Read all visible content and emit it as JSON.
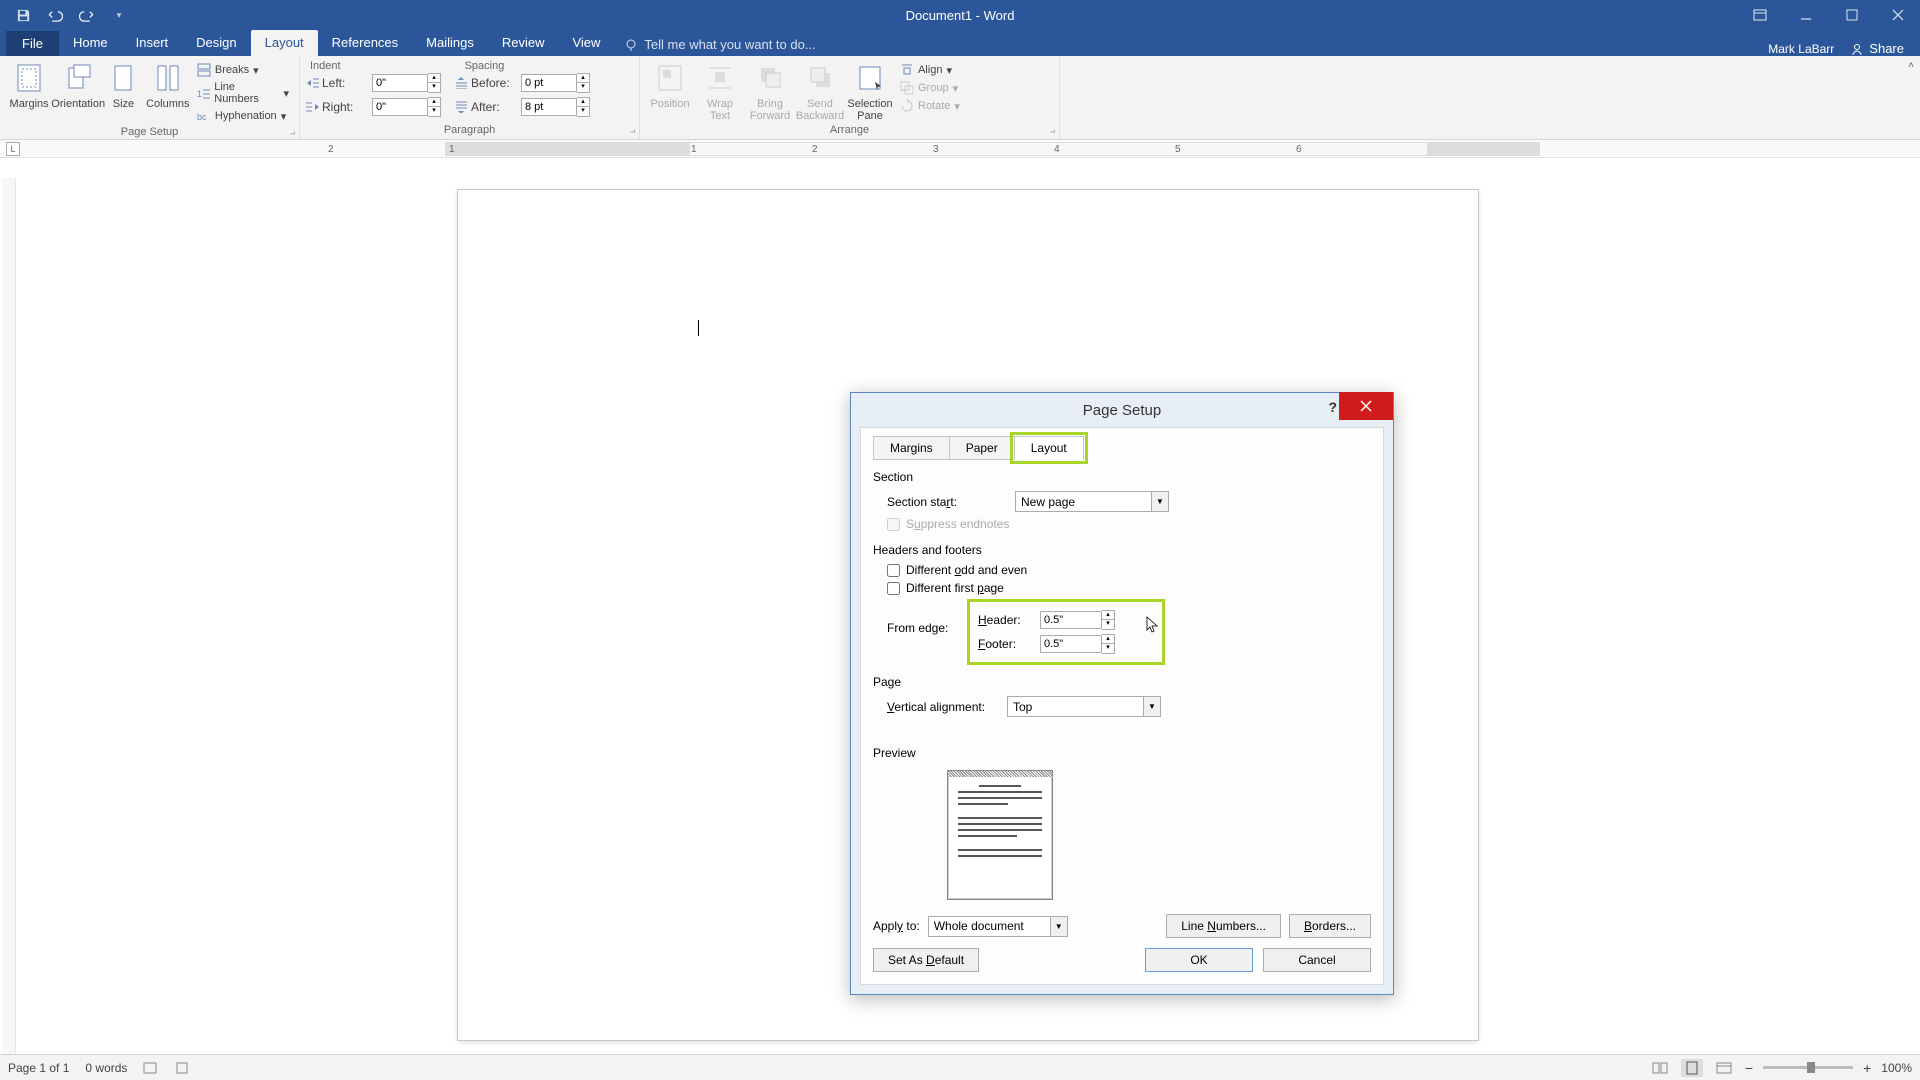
{
  "app": {
    "title": "Document1 - Word",
    "user": "Mark LaBarr",
    "share": "Share"
  },
  "qat": {
    "save": "save",
    "undo": "undo",
    "redo": "redo"
  },
  "tabs": {
    "file": "File",
    "items": [
      "Home",
      "Insert",
      "Design",
      "Layout",
      "References",
      "Mailings",
      "Review",
      "View"
    ],
    "active": "Layout",
    "tellme_placeholder": "Tell me what you want to do..."
  },
  "ribbon": {
    "page_setup": {
      "label": "Page Setup",
      "margins": "Margins",
      "orientation": "Orientation",
      "size": "Size",
      "columns": "Columns",
      "breaks": "Breaks",
      "line_numbers": "Line Numbers",
      "hyphenation": "Hyphenation"
    },
    "paragraph": {
      "label": "Paragraph",
      "indent_h": "Indent",
      "spacing_h": "Spacing",
      "left_lbl": "Left:",
      "right_lbl": "Right:",
      "before_lbl": "Before:",
      "after_lbl": "After:",
      "left_v": "0\"",
      "right_v": "0\"",
      "before_v": "0 pt",
      "after_v": "8 pt"
    },
    "arrange": {
      "label": "Arrange",
      "position": "Position",
      "wrap": "Wrap Text",
      "bring": "Bring Forward",
      "send": "Send Backward",
      "selection": "Selection Pane",
      "align": "Align",
      "group": "Group",
      "rotate": "Rotate"
    }
  },
  "ruler": {
    "marks": [
      2,
      1,
      "",
      1,
      2,
      3,
      4,
      5,
      6
    ],
    "tab_style": "L"
  },
  "dialog": {
    "title": "Page Setup",
    "tabs": {
      "margins": "Margins",
      "paper": "Paper",
      "layout": "Layout"
    },
    "section": {
      "h": "Section",
      "start_lbl": "Section start:",
      "start_v": "New page",
      "suppress": "Suppress endnotes"
    },
    "hf": {
      "h": "Headers and footers",
      "odd_even": "Different odd and even",
      "first_page": "Different first page",
      "from_edge": "From edge:",
      "header_lbl": "Header:",
      "header_v": "0.5\"",
      "footer_lbl": "Footer:",
      "footer_v": "0.5\""
    },
    "page": {
      "h": "Page",
      "valign_lbl": "Vertical alignment:",
      "valign_v": "Top"
    },
    "preview_h": "Preview",
    "apply_lbl": "Apply to:",
    "apply_v": "Whole document",
    "line_numbers_btn": "Line Numbers...",
    "borders_btn": "Borders...",
    "default_btn": "Set As Default",
    "ok": "OK",
    "cancel": "Cancel"
  },
  "status": {
    "page": "Page 1 of 1",
    "words": "0 words",
    "zoom": "100%"
  }
}
